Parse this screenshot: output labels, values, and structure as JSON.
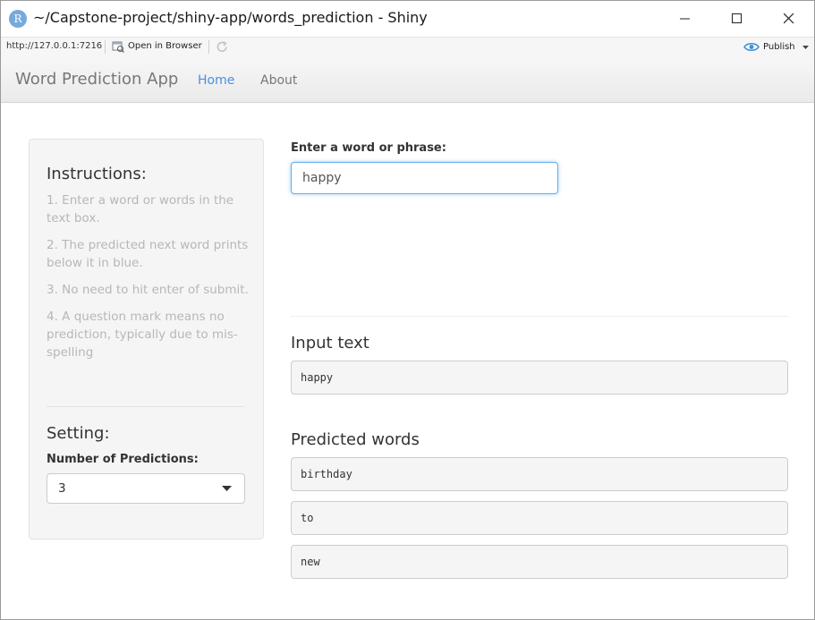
{
  "window": {
    "title": "~/Capstone-project/shiny-app/words_prediction - Shiny",
    "app_icon_letter": "R"
  },
  "toolbar": {
    "url": "http://127.0.0.1:7216",
    "open_in_browser_label": "Open in Browser",
    "publish_label": "Publish"
  },
  "navbar": {
    "brand": "Word Prediction App",
    "tabs": [
      {
        "label": "Home",
        "active": true
      },
      {
        "label": "About",
        "active": false
      }
    ]
  },
  "sidebar": {
    "instructions_title": "Instructions:",
    "instructions": [
      "1. Enter a word or words in the text box.",
      "2. The predicted next word prints below it in blue.",
      "3. No need to hit enter of submit.",
      "4. A question mark means no prediction, typically due to mis-spelling"
    ],
    "setting_title": "Setting:",
    "num_predictions_label": "Number of Predictions:",
    "num_predictions_value": "3"
  },
  "main": {
    "input_label": "Enter a word or phrase:",
    "input_value": "happy",
    "input_text_title": "Input text",
    "input_text_output": "happy",
    "predicted_title": "Predicted words",
    "predictions": [
      "birthday",
      "to",
      "new"
    ]
  },
  "colors": {
    "active_tab": "#4a8fe0",
    "instruction_text": "#b7b7b7",
    "input_focus_border": "#66afe9",
    "app_icon": "#75aadb"
  },
  "icons": {
    "app": "r-logo-icon",
    "open_in_browser": "open-in-browser-icon",
    "refresh": "refresh-icon",
    "publish": "publish-icon",
    "select_caret": "caret-down-icon"
  }
}
